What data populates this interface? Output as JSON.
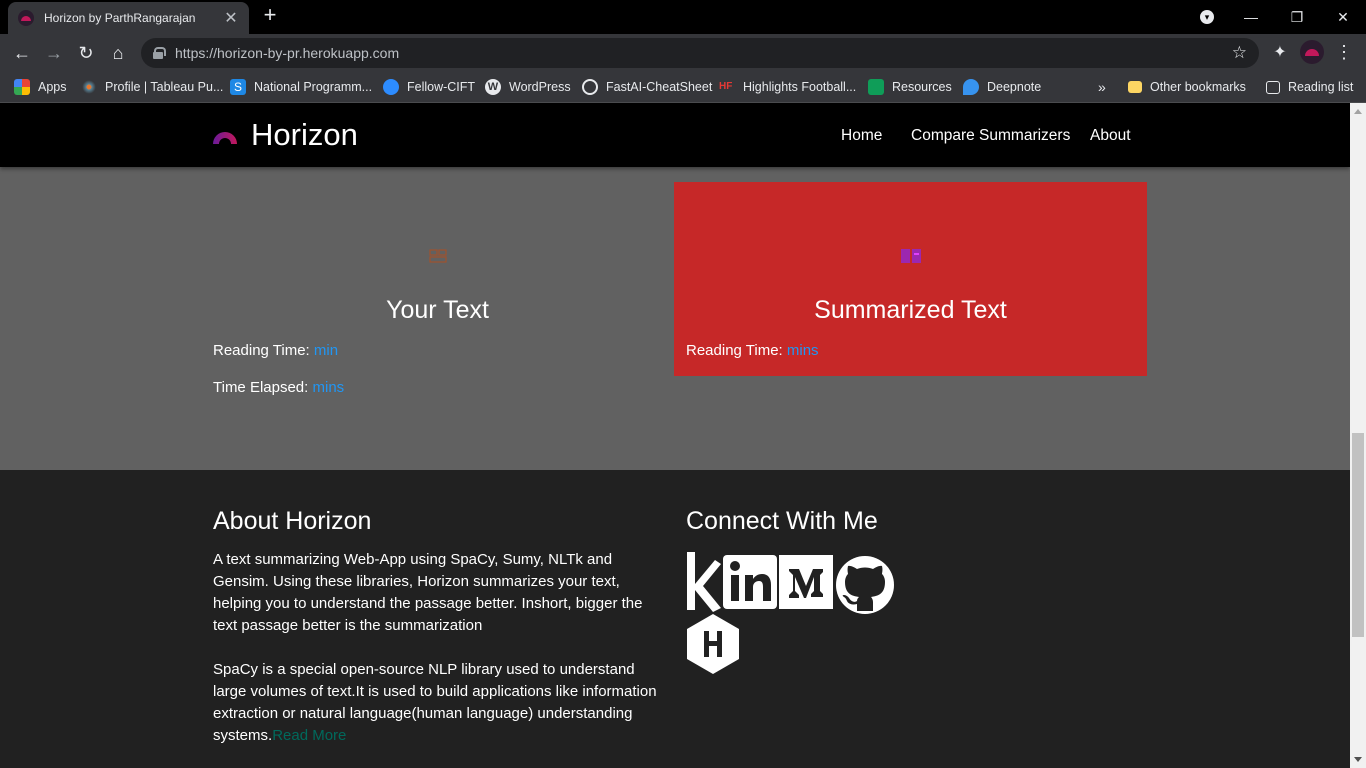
{
  "browser": {
    "tab_title": "Horizon by ParthRangarajan",
    "url": "https://horizon-by-pr.herokuapp.com",
    "bookmarks": [
      {
        "label": "Apps",
        "icon": "apps-grid-icon"
      },
      {
        "label": "Profile | Tableau Pu...",
        "icon": "tableau-icon"
      },
      {
        "label": "National Programm...",
        "icon": "swayam-icon"
      },
      {
        "label": "Fellow-CIFT",
        "icon": "zoom-icon"
      },
      {
        "label": "WordPress",
        "icon": "wordpress-icon"
      },
      {
        "label": "FastAI-CheatSheet",
        "icon": "globe-icon"
      },
      {
        "label": "Highlights Football...",
        "icon": "hf-icon"
      },
      {
        "label": "Resources",
        "icon": "sheets-icon"
      },
      {
        "label": "Deepnote",
        "icon": "deepnote-icon"
      }
    ],
    "overflow_label": "»",
    "other_bookmarks": "Other bookmarks",
    "reading_list": "Reading list"
  },
  "site": {
    "brand": "Horizon",
    "nav": [
      "Home",
      "Compare Summarizers",
      "About"
    ]
  },
  "cards": {
    "your_text": {
      "title": "Your Text",
      "reading_label": "Reading Time:",
      "reading_value": "min",
      "elapsed_label": "Time Elapsed:",
      "elapsed_value": "mins"
    },
    "summarized": {
      "title": "Summarized Text",
      "reading_label": "Reading Time:",
      "reading_value": "mins"
    }
  },
  "footer": {
    "about_title": "About Horizon",
    "about_p1": "A text summarizing Web-App using SpaCy, Sumy, NLTk and Gensim. Using these libraries, Horizon summarizes your text, helping you to understand the passage better. Inshort, bigger the text passage better is the summarization",
    "about_p2": "SpaCy is a special open-source NLP library used to understand large volumes of text.It is used to build applications like information extraction or natural language(human language) understanding systems.",
    "read_more": "Read More",
    "connect_title": "Connect With Me",
    "social_icons": [
      "kaggle-icon",
      "linkedin-icon",
      "medium-icon",
      "github-icon",
      "hackerrank-icon"
    ]
  },
  "colors": {
    "page_bg": "#616161",
    "summary_card": "#c62828",
    "footer_bg": "#212121",
    "link_blue": "#2196f3",
    "read_more": "#00695c"
  }
}
